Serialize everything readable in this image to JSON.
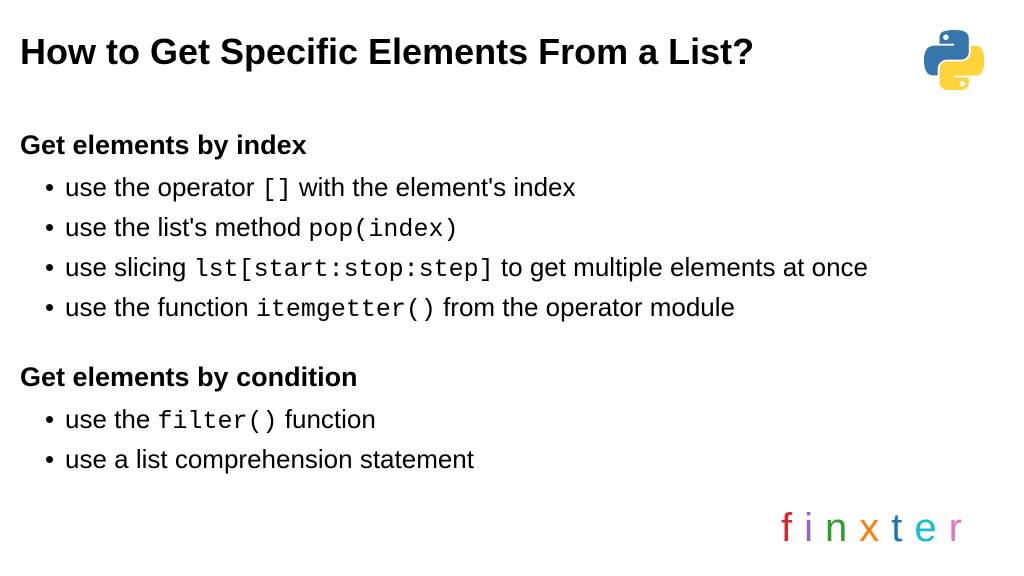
{
  "title": "How to Get Specific Elements From a List?",
  "section1": {
    "heading": "Get elements by index",
    "items": {
      "i0_pre": "use the operator ",
      "i0_code": "[]",
      "i0_post": " with the element's index",
      "i1_pre": "use the list's method ",
      "i1_code": "pop(index)",
      "i2_pre": "use slicing ",
      "i2_code": "lst[start:stop:step]",
      "i2_post": " to get multiple elements at once",
      "i3_pre": "use the function ",
      "i3_code": "itemgetter()",
      "i3_post": " from the operator module"
    }
  },
  "section2": {
    "heading": "Get elements by condition",
    "items": {
      "i0_pre": "use the ",
      "i0_code": "filter()",
      "i0_post": " function",
      "i1": "use a list comprehension statement"
    }
  },
  "logo": {
    "f": "f",
    "i": "i",
    "n": "n",
    "x": "x",
    "t": "t",
    "e": "e",
    "r": "r"
  }
}
